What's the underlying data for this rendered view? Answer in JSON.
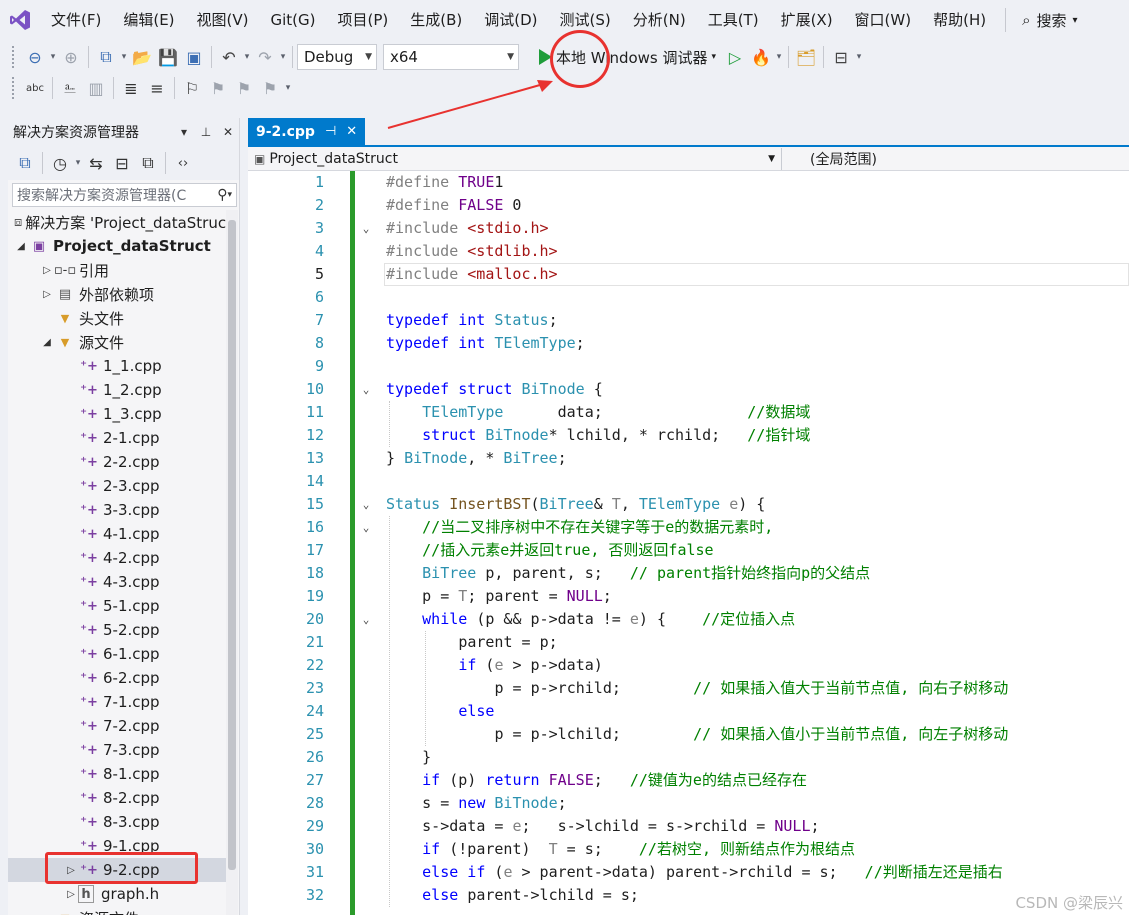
{
  "menu": {
    "items": [
      "文件(F)",
      "编辑(E)",
      "视图(V)",
      "Git(G)",
      "项目(P)",
      "生成(B)",
      "调试(D)",
      "测试(S)",
      "分析(N)",
      "工具(T)",
      "扩展(X)",
      "窗口(W)",
      "帮助(H)"
    ],
    "search_label": "搜索"
  },
  "toolbar": {
    "config": "Debug",
    "platform": "x64",
    "run_label": "本地 Windows 调试器"
  },
  "solution_explorer": {
    "title": "解决方案资源管理器",
    "search_placeholder": "搜索解决方案资源管理器(C",
    "items": [
      {
        "label": "解决方案 'Project_dataStruct'",
        "expander": "",
        "icon": "solution-icon",
        "indent": 0,
        "bold": false,
        "selected": false
      },
      {
        "label": "Project_dataStruct",
        "expander": "◢",
        "icon": "project-icon",
        "indent": 0,
        "bold": true,
        "selected": false
      },
      {
        "label": "引用",
        "expander": "▷",
        "icon": "references-icon",
        "indent": 1,
        "bold": false,
        "selected": false
      },
      {
        "label": "外部依赖项",
        "expander": "▷",
        "icon": "external-deps-icon",
        "indent": 1,
        "bold": false,
        "selected": false
      },
      {
        "label": "头文件",
        "expander": "",
        "icon": "filter-folder-icon",
        "indent": 1,
        "bold": false,
        "selected": false
      },
      {
        "label": "源文件",
        "expander": "◢",
        "icon": "filter-folder-icon",
        "indent": 1,
        "bold": false,
        "selected": false
      },
      {
        "label": "1_1.cpp",
        "expander": "",
        "icon": "cpp-file-icon",
        "indent": 2,
        "bold": false,
        "selected": false
      },
      {
        "label": "1_2.cpp",
        "expander": "",
        "icon": "cpp-file-icon",
        "indent": 2,
        "bold": false,
        "selected": false
      },
      {
        "label": "1_3.cpp",
        "expander": "",
        "icon": "cpp-file-icon",
        "indent": 2,
        "bold": false,
        "selected": false
      },
      {
        "label": "2-1.cpp",
        "expander": "",
        "icon": "cpp-file-icon",
        "indent": 2,
        "bold": false,
        "selected": false
      },
      {
        "label": "2-2.cpp",
        "expander": "",
        "icon": "cpp-file-icon",
        "indent": 2,
        "bold": false,
        "selected": false
      },
      {
        "label": "2-3.cpp",
        "expander": "",
        "icon": "cpp-file-icon",
        "indent": 2,
        "bold": false,
        "selected": false
      },
      {
        "label": "3-3.cpp",
        "expander": "",
        "icon": "cpp-file-icon",
        "indent": 2,
        "bold": false,
        "selected": false
      },
      {
        "label": "4-1.cpp",
        "expander": "",
        "icon": "cpp-file-icon",
        "indent": 2,
        "bold": false,
        "selected": false
      },
      {
        "label": "4-2.cpp",
        "expander": "",
        "icon": "cpp-file-icon",
        "indent": 2,
        "bold": false,
        "selected": false
      },
      {
        "label": "4-3.cpp",
        "expander": "",
        "icon": "cpp-file-icon",
        "indent": 2,
        "bold": false,
        "selected": false
      },
      {
        "label": "5-1.cpp",
        "expander": "",
        "icon": "cpp-file-icon",
        "indent": 2,
        "bold": false,
        "selected": false
      },
      {
        "label": "5-2.cpp",
        "expander": "",
        "icon": "cpp-file-icon",
        "indent": 2,
        "bold": false,
        "selected": false
      },
      {
        "label": "6-1.cpp",
        "expander": "",
        "icon": "cpp-file-icon",
        "indent": 2,
        "bold": false,
        "selected": false
      },
      {
        "label": "6-2.cpp",
        "expander": "",
        "icon": "cpp-file-icon",
        "indent": 2,
        "bold": false,
        "selected": false
      },
      {
        "label": "7-1.cpp",
        "expander": "",
        "icon": "cpp-file-icon",
        "indent": 2,
        "bold": false,
        "selected": false
      },
      {
        "label": "7-2.cpp",
        "expander": "",
        "icon": "cpp-file-icon",
        "indent": 2,
        "bold": false,
        "selected": false
      },
      {
        "label": "7-3.cpp",
        "expander": "",
        "icon": "cpp-file-icon",
        "indent": 2,
        "bold": false,
        "selected": false
      },
      {
        "label": "8-1.cpp",
        "expander": "",
        "icon": "cpp-file-icon",
        "indent": 2,
        "bold": false,
        "selected": false
      },
      {
        "label": "8-2.cpp",
        "expander": "",
        "icon": "cpp-file-icon",
        "indent": 2,
        "bold": false,
        "selected": false
      },
      {
        "label": "8-3.cpp",
        "expander": "",
        "icon": "cpp-file-icon",
        "indent": 2,
        "bold": false,
        "selected": false
      },
      {
        "label": "9-1.cpp",
        "expander": "",
        "icon": "cpp-file-icon",
        "indent": 2,
        "bold": false,
        "selected": false
      },
      {
        "label": "9-2.cpp",
        "expander": "▷",
        "icon": "cpp-file-icon",
        "indent": 2,
        "bold": false,
        "selected": true
      },
      {
        "label": "graph.h",
        "expander": "▷",
        "icon": "header-file-icon",
        "indent": 2,
        "bold": false,
        "selected": false
      },
      {
        "label": "资源文件",
        "expander": "",
        "icon": "filter-folder-icon",
        "indent": 1,
        "bold": false,
        "selected": false
      }
    ]
  },
  "editor": {
    "tab_label": "9-2.cpp",
    "project_scope": "Project_dataStruct",
    "member_scope": "(全局范围)",
    "current_line": 5,
    "lines": [
      {
        "n": 1,
        "fold": "",
        "indent": 0,
        "tokens": [
          [
            "pp",
            "#define "
          ],
          [
            "mac",
            "TRUE"
          ],
          [
            "",
            "1"
          ]
        ]
      },
      {
        "n": 2,
        "fold": "",
        "indent": 0,
        "tokens": [
          [
            "pp",
            "#define "
          ],
          [
            "mac",
            "FALSE"
          ],
          [
            "",
            " 0"
          ]
        ]
      },
      {
        "n": 3,
        "fold": "⌄",
        "indent": 0,
        "tokens": [
          [
            "pp",
            "#include "
          ],
          [
            "str",
            "<stdio.h>"
          ]
        ]
      },
      {
        "n": 4,
        "fold": "",
        "indent": 0,
        "tokens": [
          [
            "pp",
            "#include "
          ],
          [
            "str",
            "<stdlib.h>"
          ]
        ]
      },
      {
        "n": 5,
        "fold": "",
        "indent": 0,
        "tokens": [
          [
            "pp",
            "#include "
          ],
          [
            "str",
            "<malloc.h>"
          ]
        ]
      },
      {
        "n": 6,
        "fold": "",
        "indent": 0,
        "tokens": []
      },
      {
        "n": 7,
        "fold": "",
        "indent": 0,
        "tokens": [
          [
            "kw",
            "typedef "
          ],
          [
            "kw",
            "int "
          ],
          [
            "ty",
            "Status"
          ],
          [
            "",
            ";"
          ]
        ]
      },
      {
        "n": 8,
        "fold": "",
        "indent": 0,
        "tokens": [
          [
            "kw",
            "typedef "
          ],
          [
            "kw",
            "int "
          ],
          [
            "ty",
            "TElemType"
          ],
          [
            "",
            ";"
          ]
        ]
      },
      {
        "n": 9,
        "fold": "",
        "indent": 0,
        "tokens": []
      },
      {
        "n": 10,
        "fold": "⌄",
        "indent": 0,
        "tokens": [
          [
            "kw",
            "typedef "
          ],
          [
            "kw",
            "struct "
          ],
          [
            "ty",
            "BiTnode"
          ],
          [
            "",
            " {"
          ]
        ]
      },
      {
        "n": 11,
        "fold": "",
        "indent": 1,
        "tokens": [
          [
            "ty",
            "TElemType"
          ],
          [
            "",
            "      data;"
          ],
          [
            "",
            "                "
          ],
          [
            "cm",
            "//数据域"
          ]
        ]
      },
      {
        "n": 12,
        "fold": "",
        "indent": 1,
        "tokens": [
          [
            "kw",
            "struct "
          ],
          [
            "ty",
            "BiTnode"
          ],
          [
            "",
            "* lchild, * rchild;   "
          ],
          [
            "cm",
            "//指针域"
          ]
        ]
      },
      {
        "n": 13,
        "fold": "",
        "indent": 0,
        "tokens": [
          [
            "",
            "} "
          ],
          [
            "ty",
            "BiTnode"
          ],
          [
            "",
            ", * "
          ],
          [
            "ty",
            "BiTree"
          ],
          [
            "",
            ";"
          ]
        ]
      },
      {
        "n": 14,
        "fold": "",
        "indent": 0,
        "tokens": []
      },
      {
        "n": 15,
        "fold": "⌄",
        "indent": 0,
        "tokens": [
          [
            "ty",
            "Status "
          ],
          [
            "fn",
            "InsertBST"
          ],
          [
            "",
            "("
          ],
          [
            "ty",
            "BiTree"
          ],
          [
            "",
            "& "
          ],
          [
            "par",
            "T"
          ],
          [
            "",
            ", "
          ],
          [
            "ty",
            "TElemType "
          ],
          [
            "par",
            "e"
          ],
          [
            "",
            ") {"
          ]
        ]
      },
      {
        "n": 16,
        "fold": "⌄",
        "indent": 1,
        "tokens": [
          [
            "cm",
            "//当二叉排序树中不存在关键字等于e的数据元素时,"
          ]
        ]
      },
      {
        "n": 17,
        "fold": "",
        "indent": 1,
        "tokens": [
          [
            "cm",
            "//插入元素e并返回true, 否则返回false"
          ]
        ]
      },
      {
        "n": 18,
        "fold": "",
        "indent": 1,
        "tokens": [
          [
            "ty",
            "BiTree "
          ],
          [
            "",
            "p, parent, s;   "
          ],
          [
            "cm",
            "// parent指针始终指向p的父结点"
          ]
        ]
      },
      {
        "n": 19,
        "fold": "",
        "indent": 1,
        "tokens": [
          [
            "",
            "p = "
          ],
          [
            "par",
            "T"
          ],
          [
            "",
            "; parent = "
          ],
          [
            "mac",
            "NULL"
          ],
          [
            "",
            ";"
          ]
        ]
      },
      {
        "n": 20,
        "fold": "⌄",
        "indent": 1,
        "tokens": [
          [
            "kw",
            "while "
          ],
          [
            "",
            "(p && p->data != "
          ],
          [
            "par",
            "e"
          ],
          [
            "",
            ") {    "
          ],
          [
            "cm",
            "//定位插入点"
          ]
        ]
      },
      {
        "n": 21,
        "fold": "",
        "indent": 2,
        "tokens": [
          [
            "",
            "parent = p;"
          ]
        ]
      },
      {
        "n": 22,
        "fold": "",
        "indent": 2,
        "tokens": [
          [
            "kw",
            "if "
          ],
          [
            "",
            "("
          ],
          [
            "par",
            "e"
          ],
          [
            "",
            " > p->data)"
          ]
        ]
      },
      {
        "n": 23,
        "fold": "",
        "indent": 3,
        "tokens": [
          [
            "",
            "p = p->rchild;        "
          ],
          [
            "cm",
            "// 如果插入值大于当前节点值, 向右子树移动"
          ]
        ]
      },
      {
        "n": 24,
        "fold": "",
        "indent": 2,
        "tokens": [
          [
            "kw",
            "else"
          ]
        ]
      },
      {
        "n": 25,
        "fold": "",
        "indent": 3,
        "tokens": [
          [
            "",
            "p = p->lchild;        "
          ],
          [
            "cm",
            "// 如果插入值小于当前节点值, 向左子树移动"
          ]
        ]
      },
      {
        "n": 26,
        "fold": "",
        "indent": 1,
        "tokens": [
          [
            "",
            "}"
          ]
        ]
      },
      {
        "n": 27,
        "fold": "",
        "indent": 1,
        "tokens": [
          [
            "kw",
            "if "
          ],
          [
            "",
            "(p) "
          ],
          [
            "kw",
            "return "
          ],
          [
            "mac",
            "FALSE"
          ],
          [
            "",
            ";   "
          ],
          [
            "cm",
            "//键值为e的结点已经存在"
          ]
        ]
      },
      {
        "n": 28,
        "fold": "",
        "indent": 1,
        "tokens": [
          [
            "",
            "s = "
          ],
          [
            "kw",
            "new "
          ],
          [
            "ty",
            "BiTnode"
          ],
          [
            "",
            ";"
          ]
        ]
      },
      {
        "n": 29,
        "fold": "",
        "indent": 1,
        "tokens": [
          [
            "",
            "s->data = "
          ],
          [
            "par",
            "e"
          ],
          [
            "",
            ";   s->lchild = s->rchild = "
          ],
          [
            "mac",
            "NULL"
          ],
          [
            "",
            ";"
          ]
        ]
      },
      {
        "n": 30,
        "fold": "",
        "indent": 1,
        "tokens": [
          [
            "kw",
            "if "
          ],
          [
            "",
            "(!parent)  "
          ],
          [
            "par",
            "T"
          ],
          [
            "",
            " = s;    "
          ],
          [
            "cm",
            "//若树空, 则新结点作为根结点"
          ]
        ]
      },
      {
        "n": 31,
        "fold": "",
        "indent": 1,
        "tokens": [
          [
            "kw",
            "else if "
          ],
          [
            "",
            "("
          ],
          [
            "par",
            "e"
          ],
          [
            "",
            " > parent->data) parent->rchild = s;   "
          ],
          [
            "cm",
            "//判断插左还是插右"
          ]
        ]
      },
      {
        "n": 32,
        "fold": "",
        "indent": 1,
        "tokens": [
          [
            "kw",
            "else "
          ],
          [
            "",
            "parent->lchild = s;"
          ]
        ]
      }
    ]
  },
  "watermark": "CSDN @梁辰兴",
  "annotation_color": "#e8322f"
}
